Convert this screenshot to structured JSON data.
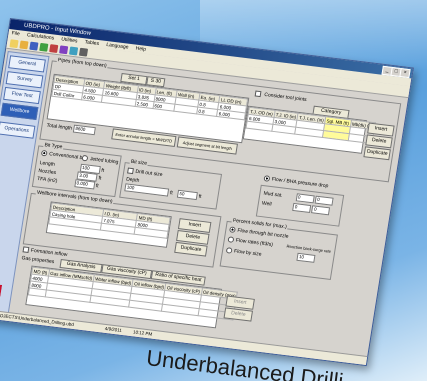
{
  "window": {
    "title": "UBDPRO - Input Window"
  },
  "menu": [
    "File",
    "Calculations",
    "Utilities",
    "Tables",
    "Language",
    "Help"
  ],
  "sidebar": {
    "items": [
      {
        "label": "General"
      },
      {
        "label": "Survey"
      },
      {
        "label": "Flow Test"
      },
      {
        "label": "Wellbore"
      },
      {
        "label": "Operations"
      }
    ],
    "logo": "RI"
  },
  "pipe_section": {
    "label": "Pipes (from top down)",
    "tabs": [
      "Set 1",
      "S 30"
    ],
    "headers": [
      "Description",
      "OD (in)",
      "Weight (lb/ft)",
      "ID (in)",
      "Len. (ft)",
      "Wall (in)",
      "Ea. (in)",
      "LL OD (in)"
    ],
    "rows": [
      [
        "DP",
        "4.500",
        "16.600",
        "3.826",
        "8000",
        "",
        "0.8",
        "6.000"
      ],
      [
        "Drill Collar",
        "6.000",
        "",
        "2.500",
        "600",
        "",
        "0.8",
        "6.000"
      ]
    ],
    "total_label": "Total length",
    "total_value": "8600",
    "annular_button": "Enter annular length = MWD/TD",
    "adjust_button": "Adjust segment at bit length"
  },
  "options": {
    "consider_tool_joints": "Consider tool joints"
  },
  "tool_joint_grid": {
    "headers": [
      "T.J. OD (in)",
      "T.J. ID (in)",
      "T.J. Len. (in)",
      "Sgl. MB (ft)",
      "Mb(dk) (in)"
    ],
    "rows": [
      [
        "6.000",
        "3.000",
        "",
        "",
        ""
      ],
      [
        "",
        "",
        "",
        "",
        ""
      ]
    ],
    "category_label": "Category"
  },
  "side_buttons": [
    "Insert",
    "Delete",
    "Duplicate"
  ],
  "bit_type": {
    "label": "Bit Type",
    "opt1": "Conventional bit",
    "opt2": "Jetted tubing",
    "length_label": "Length",
    "length_value": "100",
    "length_unit": "ft",
    "nozzles_label": "Nozzles",
    "nozzles_value": "3.00",
    "nozzles_unit": "ft",
    "tfa_label": "TFA (in2)",
    "tfa_value": "0.000",
    "tfa_unit": "ft"
  },
  "bit_size": {
    "label": "Bit size",
    "opt": "Drill out size",
    "depth_label": "Depth",
    "depth_value": "100",
    "depth_unit": "ft"
  },
  "casing": {
    "label": "Casing",
    "value": "50",
    "unit": "ft"
  },
  "wellbore_intervals": {
    "label": "Wellbore intervals (from top down)",
    "headers": [
      "Description",
      "I.D. (in)",
      "MD (ft)"
    ],
    "rows": [
      [
        "Casing hole",
        "7.875",
        "8000"
      ],
      [
        "",
        "",
        ""
      ]
    ],
    "buttons": [
      "Insert",
      "Delete",
      "Duplicate"
    ]
  },
  "formation_inflow": {
    "label": "Formation inflow",
    "props_label": "Gas properties",
    "tabs": [
      "Gas Analysis",
      "Gas viscosity (cP)",
      "Ratio of specific heat"
    ],
    "headers": [
      "MD (ft)",
      "Gas inflow (MMscf/d)",
      "Water inflow (bpd)",
      "Oil inflow (bpd)",
      "Oil viscosity (cP)",
      "Oil density (ppg)"
    ],
    "rows": [
      [
        "4000",
        "",
        "",
        "",
        "",
        ""
      ],
      [
        "8000",
        "",
        "",
        "",
        "",
        ""
      ],
      [
        "",
        "",
        "",
        "",
        "",
        ""
      ]
    ]
  },
  "flow_options": {
    "label": "Flow / BHA pressure drop",
    "mwd_label": "Mud sat.",
    "well_label": "Well",
    "values": [
      "0",
      "0",
      "0",
      "0"
    ]
  },
  "percent_gas": {
    "label": "Percent solids for (max.)",
    "opt1": "Flow through bit nozzle",
    "opt2": "Flow rates (ft3/s)",
    "opt3": "Flow by size",
    "fa_label": "Reaction back-surge rate",
    "fa_value": "10"
  },
  "status": {
    "path": "C:\\UBDPRO\\PROJECTS\\Underbalanced_Drilling.ubd",
    "date": "4/9/2011",
    "time": "10:12 PM"
  },
  "caption": "Underbalanced Drilli",
  "colors": {
    "titlebar": "#0a246a",
    "nav_selected": "#2e5fb7",
    "highlight": "#fffb9a"
  }
}
